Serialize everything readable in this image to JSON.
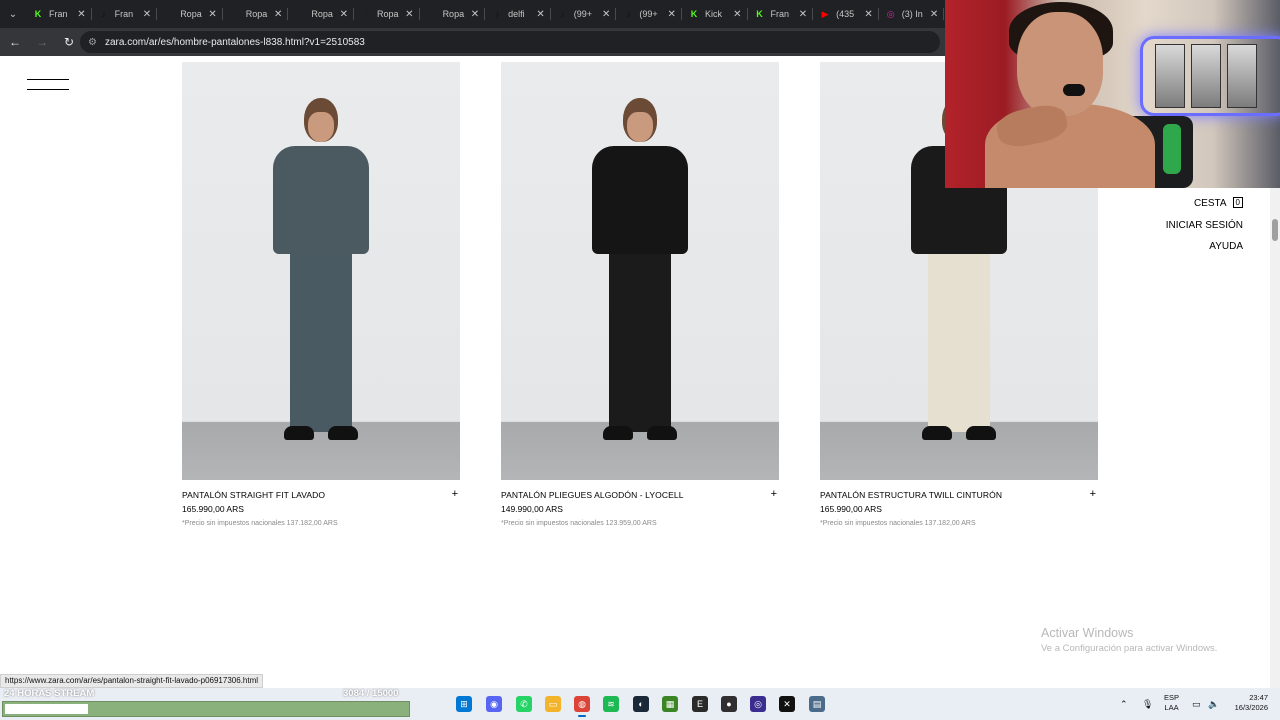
{
  "browser": {
    "tabs": [
      {
        "label": "Fran",
        "favicon": "kick-icon",
        "color": "#53fc18",
        "glyph": "K"
      },
      {
        "label": "Fran",
        "favicon": "tiktok-icon",
        "color": "#111111",
        "glyph": "♪"
      },
      {
        "label": "Ropa",
        "favicon": "s-icon",
        "color": "#202124",
        "glyph": "S"
      },
      {
        "label": "Ropa",
        "favicon": "s-icon",
        "color": "#202124",
        "glyph": "S"
      },
      {
        "label": "Ropa",
        "favicon": "s-icon",
        "color": "#202124",
        "glyph": "S"
      },
      {
        "label": "Ropa",
        "favicon": "s-icon",
        "color": "#202124",
        "glyph": "S"
      },
      {
        "label": "Ropa",
        "favicon": "s-icon",
        "color": "#202124",
        "glyph": "S"
      },
      {
        "label": "delfi",
        "favicon": "tiktok-icon",
        "color": "#111111",
        "glyph": "♪"
      },
      {
        "label": "(99+",
        "favicon": "tiktok-icon",
        "color": "#111111",
        "glyph": "♪"
      },
      {
        "label": "(99+",
        "favicon": "tiktok-icon",
        "color": "#111111",
        "glyph": "♪"
      },
      {
        "label": "Kick",
        "favicon": "kick-icon",
        "color": "#53fc18",
        "glyph": "K"
      },
      {
        "label": "Fran",
        "favicon": "kick-icon",
        "color": "#53fc18",
        "glyph": "K"
      },
      {
        "label": "(435",
        "favicon": "youtube-icon",
        "color": "#ff0000",
        "glyph": "▶"
      },
      {
        "label": "(3) In",
        "favicon": "instagram-icon",
        "color": "#d6249f",
        "glyph": "◎"
      }
    ],
    "url": "zara.com/ar/es/hombre-pantalones-l838.html?v1=2510583",
    "status_url": "https://www.zara.com/ar/es/pantalon-straight-fit-lavado-p06917306.html"
  },
  "page": {
    "products": [
      {
        "name": "PANTALÓN STRAIGHT FIT LAVADO",
        "price": "165.990,00 ARS",
        "tax_note": "*Precio sin impuestos nacionales 137.182,00 ARS",
        "add": "+",
        "jacket": "#4b5961",
        "pants": "#4a5a63"
      },
      {
        "name": "PANTALÓN PLIEGUES ALGODÓN - LYOCELL",
        "price": "149.990,00 ARS",
        "tax_note": "*Precio sin impuestos nacionales 123.959,00 ARS",
        "add": "+",
        "jacket": "#151515",
        "pants": "#1b1b1b"
      },
      {
        "name": "PANTALÓN ESTRUCTURA TWILL CINTURÓN",
        "price": "165.990,00 ARS",
        "tax_note": "*Precio sin impuestos nacionales 137.182,00 ARS",
        "add": "+",
        "jacket": "#1a1a1a",
        "pants": "#e6e0d0"
      }
    ],
    "cart_label": "CESTA",
    "cart_count": "0",
    "login_label": "INICIAR SESIÓN",
    "help_label": "AYUDA"
  },
  "windows_watermark": {
    "line1": "Activar Windows",
    "line2": "Ve a Configuración para activar Windows."
  },
  "stream_overlay": {
    "label": "24 HORAS STREAM",
    "count": "3084 / 15000",
    "progress": 0.2056
  },
  "taskbar": {
    "lang_line1": "ESP",
    "lang_line2": "LAA",
    "time": "23:47",
    "date": "16/3/2026",
    "apps": [
      {
        "name": "windows-start-icon",
        "color": "#0078d4",
        "glyph": "⊞"
      },
      {
        "name": "discord-icon",
        "color": "#5865f2",
        "glyph": "◉"
      },
      {
        "name": "whatsapp-icon",
        "color": "#25d366",
        "glyph": "✆"
      },
      {
        "name": "file-explorer-icon",
        "color": "#f3b32a",
        "glyph": "▭"
      },
      {
        "name": "chrome-icon",
        "color": "#db4437",
        "glyph": "◍"
      },
      {
        "name": "spotify-icon",
        "color": "#1db954",
        "glyph": "≋"
      },
      {
        "name": "steam-icon",
        "color": "#1b2838",
        "glyph": "◐"
      },
      {
        "name": "minecraft-icon",
        "color": "#3c8527",
        "glyph": "▦"
      },
      {
        "name": "epic-games-icon",
        "color": "#2a2a2a",
        "glyph": "E"
      },
      {
        "name": "obs-icon",
        "color": "#302e31",
        "glyph": "●"
      },
      {
        "name": "twitch-studio-icon",
        "color": "#3b2d8f",
        "glyph": "◎"
      },
      {
        "name": "capcut-icon",
        "color": "#111111",
        "glyph": "✕"
      },
      {
        "name": "calculator-icon",
        "color": "#4a6b8a",
        "glyph": "▤"
      }
    ]
  }
}
